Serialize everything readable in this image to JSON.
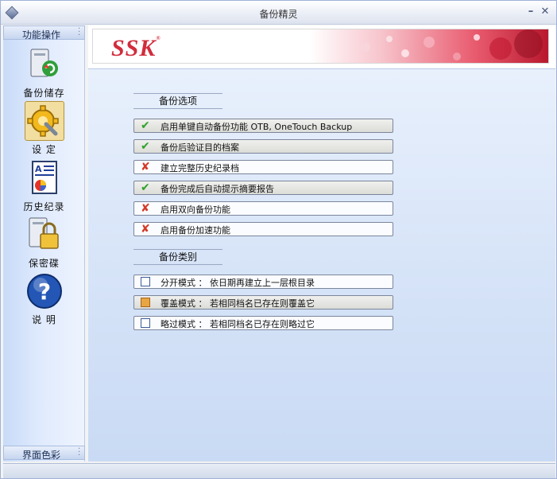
{
  "window": {
    "title": "备份精灵"
  },
  "sidebar": {
    "header": "功能操作",
    "footer": "界面色彩",
    "items": [
      {
        "label": "备份储存",
        "icon": "backup-drive-icon"
      },
      {
        "label": "设 定",
        "icon": "settings-gear-icon"
      },
      {
        "label": "历史纪录",
        "icon": "history-document-icon"
      },
      {
        "label": "保密碟",
        "icon": "lock-disk-icon"
      },
      {
        "label": "说 明",
        "icon": "help-question-icon"
      }
    ]
  },
  "banner": {
    "logo": "SSK"
  },
  "backup_options": {
    "title": "备份选项",
    "items": [
      {
        "label": "启用单键自动备份功能 OTB, OneTouch Backup",
        "state": "check"
      },
      {
        "label": "备份后验证目的档案",
        "state": "check"
      },
      {
        "label": "建立完整历史纪录档",
        "state": "cross"
      },
      {
        "label": "备份完成后自动提示摘要报告",
        "state": "check"
      },
      {
        "label": "启用双向备份功能",
        "state": "cross"
      },
      {
        "label": "启用备份加速功能",
        "state": "cross"
      }
    ]
  },
  "backup_types": {
    "title": "备份类别",
    "items": [
      {
        "label": "分开模式 ： 依日期再建立上一层根目录",
        "selected": false
      },
      {
        "label": "覆盖模式 ： 若相同档名已存在则覆盖它",
        "selected": true
      },
      {
        "label": "略过模式 ： 若相同档名已存在则略过它",
        "selected": false
      }
    ]
  },
  "colors": {
    "accent_red": "#d12d3d",
    "check_green": "#2fa12a",
    "cross_red": "#d43b27",
    "panel_blue": "#d7e4f8"
  }
}
